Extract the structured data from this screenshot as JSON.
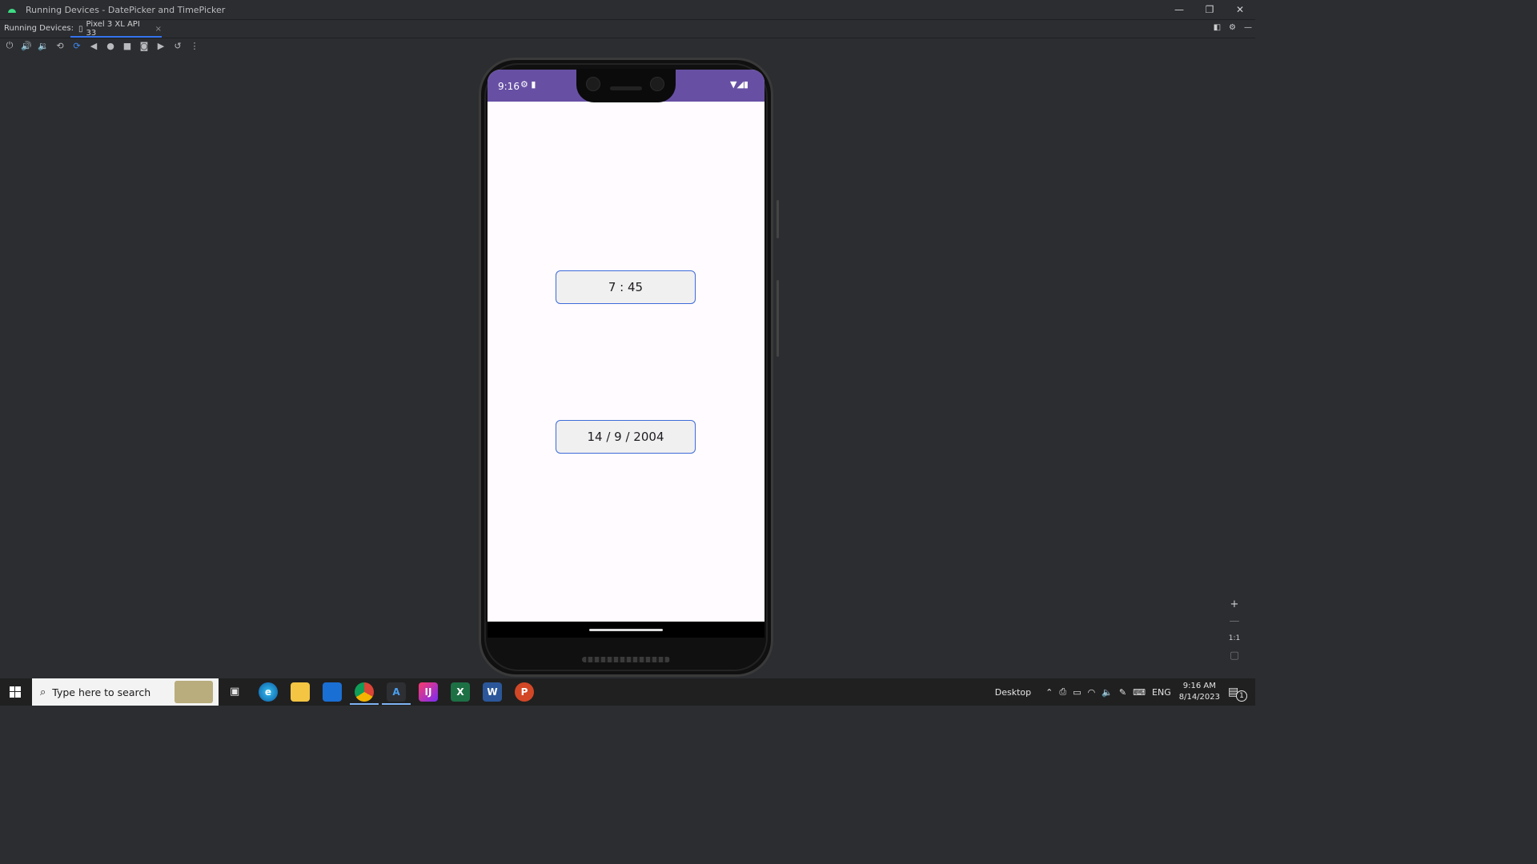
{
  "window": {
    "title": "Running Devices - DatePicker and TimePicker",
    "min": "—",
    "max": "❐",
    "close": "✕"
  },
  "tabs": {
    "label": "Running Devices:",
    "device_tab": "Pixel 3 XL API 33",
    "close": "×"
  },
  "toolbar": {
    "icons": [
      "power-icon",
      "volume-up-icon",
      "volume-down-icon",
      "rotate-left-icon",
      "rotate-right-icon",
      "back-icon",
      "home-icon",
      "overview-icon",
      "screenshot-icon",
      "screen-record-icon",
      "reset-icon",
      "more-icon"
    ]
  },
  "device": {
    "status_time": "9:16",
    "status_left_icons": "⚙ ▮",
    "status_right_icons": "▼◢▮",
    "time_value": "7 : 45",
    "date_value": "14 / 9 / 2004"
  },
  "zoom": {
    "in": "+",
    "out": "—",
    "actual": "1:1",
    "fit": "▢"
  },
  "taskbar": {
    "search_placeholder": "Type here to search",
    "desktop_label": "Desktop",
    "lang": "ENG",
    "clock_time": "9:16 AM",
    "clock_date": "8/14/2023",
    "notification_count": "1"
  },
  "colors": {
    "accent": "#6750a4",
    "focus_border": "#3d6bd8",
    "ide_bg": "#2b2d30"
  }
}
